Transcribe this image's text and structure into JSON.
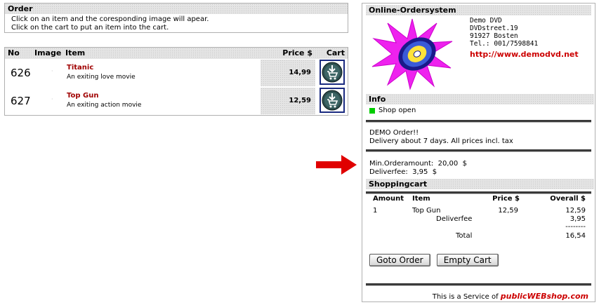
{
  "order": {
    "title": "Order",
    "instructions": [
      "Click on an item and the coresponding image will apear.",
      "Click on the cart to put an item into the cart."
    ]
  },
  "product_table": {
    "headers": {
      "no": "No",
      "image": "Image",
      "item": "Item",
      "price": "Price $",
      "cart": "Cart"
    },
    "rows": [
      {
        "no": "626",
        "title": "Titanic",
        "desc": "An exiting love movie",
        "price": "14,99"
      },
      {
        "no": "627",
        "title": "Top Gun",
        "desc": "An exiting action movie",
        "price": "12,59"
      }
    ]
  },
  "shop": {
    "title": "Online-Ordersystem",
    "company": "Demo DVD",
    "street": "DVDstreet.19",
    "city": "91927 Bosten",
    "tel": "Tel.: 001/7598841",
    "url": "http://www.demodvd.net"
  },
  "info": {
    "title": "Info",
    "status": "Shop open",
    "status_color": "#00cc00",
    "note1": "DEMO Order!!",
    "note2": "Delivery about 7 days. All prices incl. tax",
    "min_order": "Min.Orderamount:  20,00  $",
    "deliverfee": "Deliverfee:  3,95  $"
  },
  "cart": {
    "title": "Shoppingcart",
    "headers": {
      "amount": "Amount",
      "item": "Item",
      "price": "Price $",
      "overall": "Overall $"
    },
    "line": {
      "amount": "1",
      "item": "Top Gun",
      "price": "12,59",
      "overall": "12,59"
    },
    "fee_label": "Deliverfee",
    "fee_value": "3,95",
    "separator": "--------",
    "total_label": "Total",
    "total_value": "16,54",
    "goto_label": "Goto Order",
    "empty_label": "Empty Cart"
  },
  "footer": {
    "prefix": "This is a Service of",
    "brand": "publicWEBshop.com"
  },
  "colors": {
    "accent_red": "#cc0000",
    "product_title": "#a00000",
    "arrow": "#e00000"
  }
}
